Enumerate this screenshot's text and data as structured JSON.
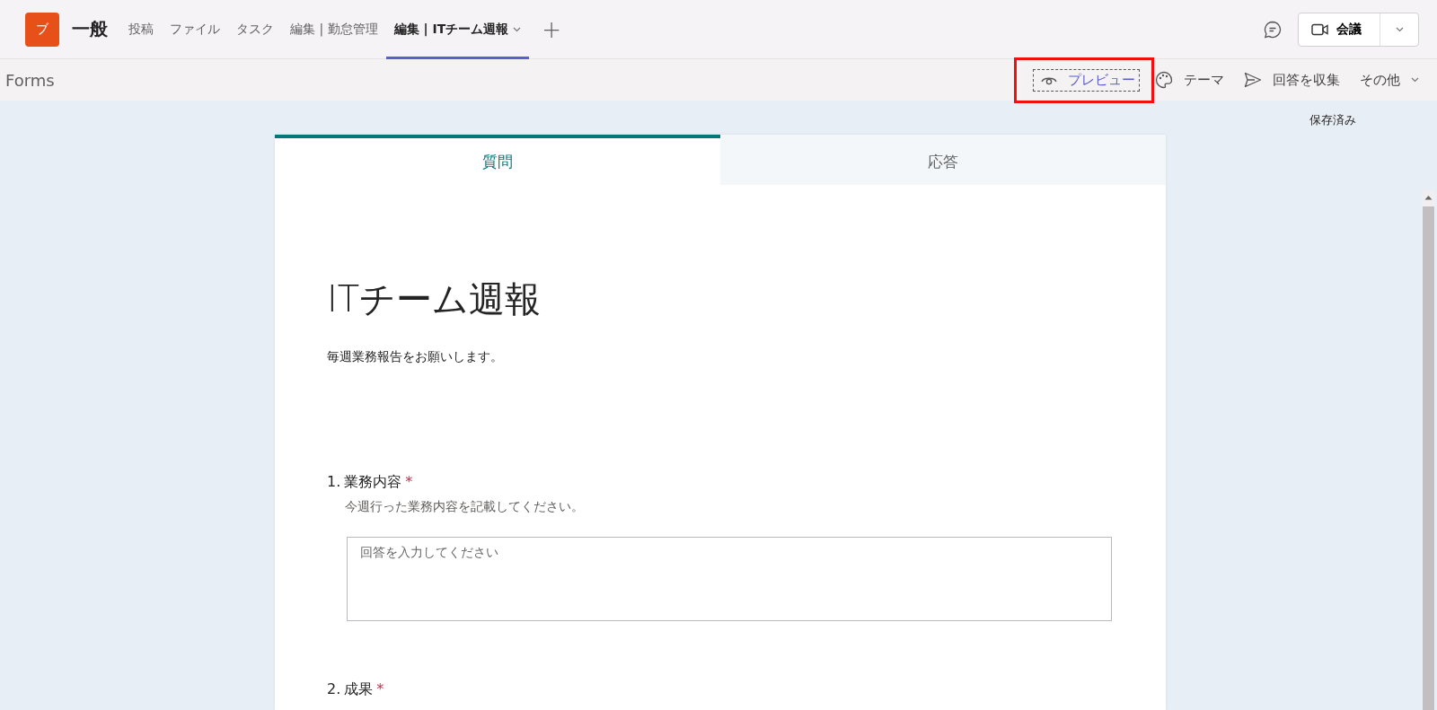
{
  "app_bar": {
    "logo_text": "ブ",
    "channel": "一般",
    "tabs": [
      {
        "label": "投稿",
        "selected": false,
        "dropdown": false
      },
      {
        "label": "ファイル",
        "selected": false,
        "dropdown": false
      },
      {
        "label": "タスク",
        "selected": false,
        "dropdown": false
      },
      {
        "label": "編集 | 勤怠管理",
        "selected": false,
        "dropdown": false
      },
      {
        "label": "編集 | ITチーム週報",
        "selected": true,
        "dropdown": true
      }
    ],
    "add_tab": "+",
    "meeting_button": "会議"
  },
  "forms_bar": {
    "title": "Forms",
    "actions": [
      {
        "kind": "preview",
        "label": "プレビュー",
        "focused": true,
        "highlighted": true,
        "dropdown": false
      },
      {
        "kind": "theme",
        "label": "テーマ",
        "focused": false,
        "highlighted": false,
        "dropdown": false
      },
      {
        "kind": "send",
        "label": "回答を収集",
        "focused": false,
        "highlighted": false,
        "dropdown": false
      },
      {
        "kind": "more",
        "label": "その他",
        "focused": false,
        "highlighted": false,
        "dropdown": true
      }
    ]
  },
  "save_status": "保存済み",
  "form": {
    "tabs": [
      {
        "label": "質問",
        "selected": true
      },
      {
        "label": "応答",
        "selected": false
      }
    ],
    "title": "ITチーム週報",
    "description": "毎週業務報告をお願いします。",
    "questions": [
      {
        "number": "1.",
        "title": "業務内容",
        "required_mark": "*",
        "subtitle": "今週行った業務内容を記載してください。",
        "placeholder": "回答を入力してください"
      },
      {
        "number": "2.",
        "title": "成果",
        "required_mark": "*"
      }
    ]
  }
}
